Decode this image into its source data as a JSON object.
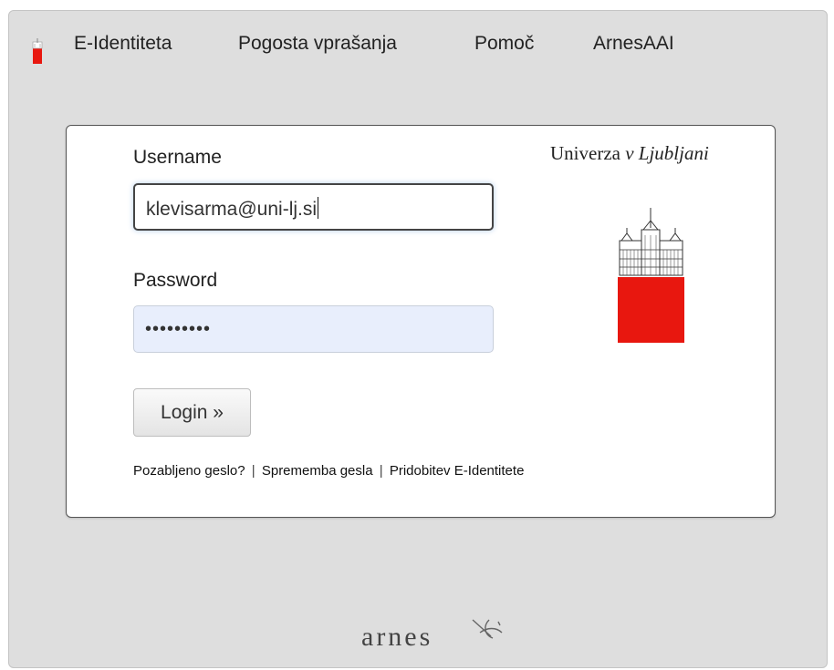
{
  "nav": {
    "items": [
      "E-Identiteta",
      "Pogosta vprašanja",
      "Pomoč",
      "ArnesAAI"
    ]
  },
  "form": {
    "username_label": "Username",
    "username_value": "klevisarma@uni-lj.si",
    "password_label": "Password",
    "password_value": "•••••••••",
    "login_label": "Login »"
  },
  "links": {
    "forgot": "Pozabljeno geslo?",
    "change": "Sprememba gesla",
    "obtain": "Pridobitev E-Identitete",
    "separator": "|"
  },
  "university": {
    "name_plain": "Univerza",
    "name_italic": "v Ljubljani"
  },
  "footer": {
    "brand": "arnes"
  },
  "colors": {
    "accent_red": "#e8170f",
    "frame_gray": "#dedede",
    "password_fill": "#e8eefc"
  }
}
